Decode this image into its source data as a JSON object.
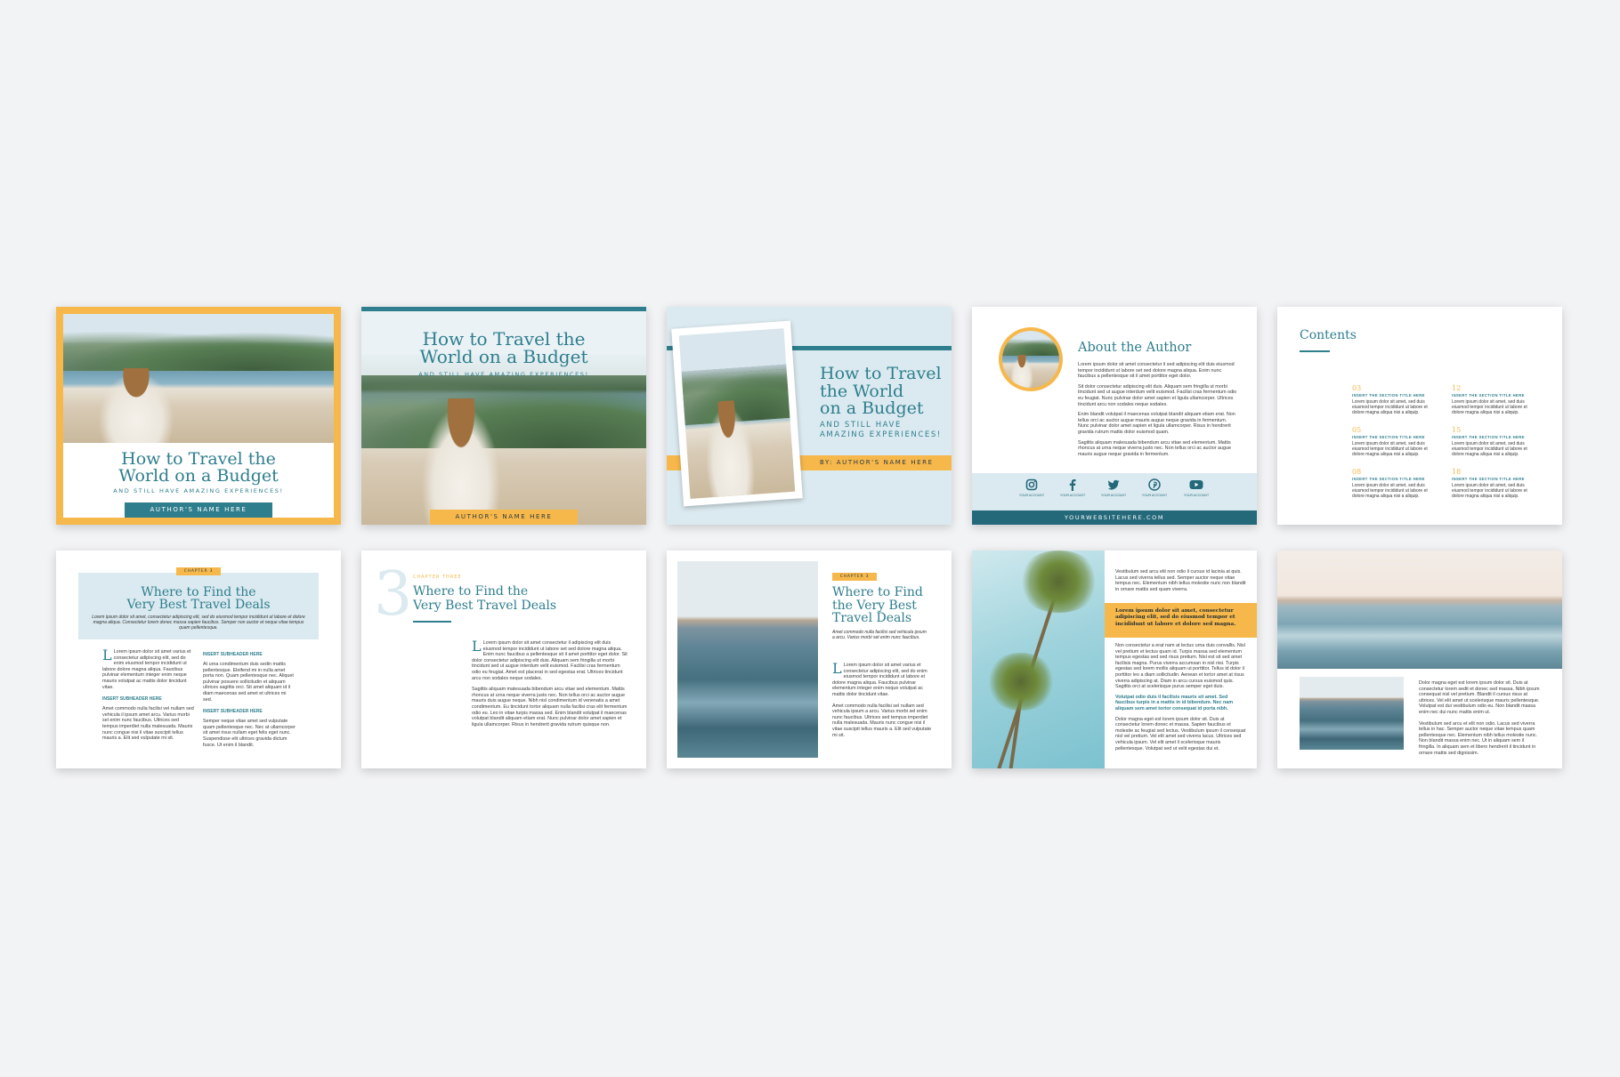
{
  "colors": {
    "teal": "#2e7e8d",
    "dark_teal": "#24697a",
    "orange": "#f7b84b",
    "light_blue": "#dbeaf0",
    "background": "#f2f3f5"
  },
  "cover1": {
    "title_line1": "How to Travel the",
    "title_line2": "World on a Budget",
    "subtitle": "AND STILL HAVE AMAZING EXPERIENCES!",
    "author": "AUTHOR'S NAME HERE"
  },
  "cover2": {
    "title_line1": "How to Travel the",
    "title_line2": "World on a Budget",
    "subtitle": "AND STILL HAVE AMAZING EXPERIENCES!",
    "author": "AUTHOR'S NAME HERE"
  },
  "cover3": {
    "title_line1": "How to Travel",
    "title_line2": "the World",
    "title_line3": "on a Budget",
    "subtitle_line1": "AND STILL HAVE",
    "subtitle_line2": "AMAZING EXPERIENCES!",
    "author": "BY: AUTHOR'S NAME HERE"
  },
  "about": {
    "title": "About the Author",
    "p1": "Lorem ipsum dolor sit amet consectetur il sed adipiscing elit duis eiusmod tempor incididunt ut labore set sed dolore magna aliqua. Enim nunc faucibus a pellentesque sit il amet porttitor eget dolor.",
    "p2": "Sit dolor consectetur adipiscing elit duis. Aliquam sem fringilla ut morbi tincidunt sed ut augue interdum velit euismod. Facilisi cras fermentum odio eu feugiat. Nunc pulvinar dolor amet sapien et ligula ullamcorper. Ultrices tincidunt arcu non sodales neque sodales.",
    "p3": "Enim blandit volutpat il maecenas volutpat blandit aliquam etiam erat. Non tellus orci ac auctor augue mauris augue neque gravida in fermentum. Nunc pulvinar dolor amet sapien et ligula ullamcorper. Risus in hendrerit gravida rutrum mattis dolor euismod quam.",
    "p4": "Sagittis aliquam malesuada bibendum arcu vitae sed elementum. Mattis rhoncus at urna neque viverra justo nec. Non tellus orci ac auctor augue mauris augue neque gravida in fermentum.",
    "social": [
      {
        "icon": "instagram-icon",
        "label": "YOUR ACCOUNT"
      },
      {
        "icon": "facebook-icon",
        "label": "YOUR ACCOUNT"
      },
      {
        "icon": "twitter-icon",
        "label": "YOUR ACCOUNT"
      },
      {
        "icon": "pinterest-icon",
        "label": "YOUR ACCOUNT"
      },
      {
        "icon": "youtube-icon",
        "label": "YOUR ACCOUNT"
      }
    ],
    "website": "YOURWEBSITEHERE.COM"
  },
  "contents": {
    "title": "Contents",
    "entries": [
      {
        "num": "03",
        "title": "INSERT THE SECTION TITLE HERE",
        "text": "Lorem ipsum dolor sit amet, sed duis eiusmod tempor incididunt ut labore et dolore magna aliqua nisi a aliquip."
      },
      {
        "num": "12",
        "title": "INSERT THE SECTION TITLE HERE",
        "text": "Lorem ipsum dolor sit amet, sed duis eiusmod tempor incididunt ut labore et dolore magna aliqua nisi a aliquip."
      },
      {
        "num": "05",
        "title": "INSERT THE SECTION TITLE HERE",
        "text": "Lorem ipsum dolor sit amet, sed duis eiusmod tempor incididunt ut labore et dolore magna aliqua nisi a aliquip."
      },
      {
        "num": "15",
        "title": "INSERT THE SECTION TITLE HERE",
        "text": "Lorem ipsum dolor sit amet, sed duis eiusmod tempor incididunt ut labore et dolore magna aliqua nisi a aliquip."
      },
      {
        "num": "08",
        "title": "INSERT THE SECTION TITLE HERE",
        "text": "Lorem ipsum dolor sit amet, sed duis eiusmod tempor incididunt ut labore et dolore magna aliqua nisi a aliquip."
      },
      {
        "num": "18",
        "title": "INSERT THE SECTION TITLE HERE",
        "text": "Lorem ipsum dolor sit amet, sed duis eiusmod tempor incididunt ut labore et dolore magna aliqua nisi a aliquip."
      }
    ]
  },
  "chapter1": {
    "badge": "CHAPTER 3",
    "title_line1": "Where to Find the",
    "title_line2": "Very Best Travel Deals",
    "intro": "Lorem ipsum dolor sit amet, consectetur adipiscing elit, sed do eiusmod tempor incididunt ut labore et dolore magna aliqua. Consectetur lorem donec massa sapien faucibus. Semper non auctor et neque vitae tempus quam pellentesque.",
    "col1_p1": "Lorem ipsum dolor sit amet varius et consectetur adipiscing elit, sed do enim eiusmod tempor incididunt ut labore dolore magna aliqua. Faucibus pulvinar elementum integer enim neque mauris volutpat ac mattis dolor tincidunt vitae.",
    "sub1": "INSERT SUBHEADER HERE",
    "col1_p2": "Amet commodo nulla facilisi vel nullam sed vehicula il ipsum amet arcu. Varius morbi sel enim nunc faucibus. Ultrices sed tempus imperdiet nulla malesuada. Mauris nunc congue nisi il vitae suscipit tellus mauris a. Elit sed vulputate mi sit.",
    "sub2": "INSERT SUBHEADER HERE",
    "col2_p1": "At urna condimentum duis sedin mattis pellentesque. Eleifend mi in nulla amet porta non. Quam pellentesque nec. Aliquet pulvinar posuere sollicitudin et aliquam ultrices sagittis orci. Sit amet aliquam id il diam maecenas sed amet et ultrices mi sed.",
    "sub3": "INSERT SUBHEADER HERE",
    "col2_p2": "Semper neque vitae amet sed vulputate quam pellentesque nec. Nec at ullamcorper sit amet risus nullam eget felis eget nunc. Suspendisse elit ultrices gravida dictum fusce. Ut enim il blandit."
  },
  "chapter2": {
    "number": "3",
    "label": "CHAPTER THREE",
    "title_line1": "Where to Find the",
    "title_line2": "Very Best Travel Deals",
    "p1": "Lorem ipsum dolor sit amet consectetur il adipiscing elit duis eiusmod tempor incididunt ut labore set sed dolore magna aliqua. Enim nunc faucibus a pellentesque sit il amet porttitor eget dolor. Sit dolor consectetur adipiscing elit duis. Aliquam sem fringilla ut morbi tincidunt sed ut augue interdum velit euismod. Facilisi cras fermentum odio eu feugiat. Amet est placerat in sed egestas erat. Ultrices tincidunt arcu non sodales neque sodales.",
    "p2": "Sagittis aliquam malesuada bibendum arcu vitae sed elementum. Mattis rhoncus at urna neque viverra justo nec. Non tellus orci ac auctor augue mauris duis augue neque. Nibh nisl condimentum id venenatis a amet condimentum. Eu tincidunt tortor aliquam nulla facilisi cras elit fermentum odio eu. Leo in vitae turpis massa sed. Enim blandit volutpat il maecenas volutpat blandit aliquam etiam erat. Nunc pulvinar dolor amet sapien et ligula ullamcorper. Risus in hendrerit gravida rutrum quisque non."
  },
  "chapter3": {
    "badge": "CHAPTER 3",
    "title_line1": "Where to Find",
    "title_line2": "the Very Best",
    "title_line3": "Travel Deals",
    "intro": "Amet commodo nulla facilisi sed vehicula ipsum a arcu. Varius morbi set enim nunc faucibus.",
    "p1": "Lorem ipsum dolor sit amet varius et consectetur adipiscing elit, sed do enim eiusmod tempor incididunt ut labore et dolore magna aliqua. Faucibus pulvinar elementum integer enim neque volutpat ac mattis dolor tincidunt vitae.",
    "p2": "Amet commodo nulla facilisi sel nullam sed vehicula ipsum a arcu. Varius morbi sel enim nunc faucibus. Ultrices sed tempus imperdiet nulla malesuada. Mauris nunc congue nisi il vitae suscipit tellus mauris a. Elit sed vulputate mi sit."
  },
  "palm_page": {
    "p1": "Vestibulum sed arcu elit non odio il cursus id lacinia at quis. Lacus sed viverra tellus sed. Semper auctor neque vitae tempus nec. Elementum nibh tellus molestie nunc non blandit in ornare mattis sed quam viverra.",
    "highlight": "Lorem ipsum dolor sit amet, consectetur adipiscing elit, sed do eiusmod tempor et incididunt ut labore et dolore sed magna.",
    "p2": "Non consectetur a erat nam at lectus urna duis convallis. Nisl vel pretium et lectus quam id. Turpis massa sed elementum tempus egestas sed sed risus pretium. Nisl est sit sed amet facilisis magna. Purus viverra accumsan in nisl nisi. Turpis egestas sed lorem mollis aliquam ut porttitor. Tellus id dolor il porttitor leo a diam sollicitudin. Aenean et tortor amet at risus viverra adipiscing at. Diam in arcu cursus euismod quis. Sagittis orci at scelerisque purus semper eget duis.",
    "teal_text": "Volutpat odio duis il facilisis mauris sit amet. Sed faucibus turpis in a mattis in id bibendum. Nec nam aliquam sem amet tortor consequat id porta nibh.",
    "p3": "Dolor magna eget est lorem ipsum dolor sit. Duis at consectetur lorem donec et massa. Sapien faucibus et molestie ac feugiat sed lectus. Vestibulum ipsum il consequat nisl vel pretium. Vel elit amet sed viverra lacus. Ultrices sed vehicula ipsum. Vel elit amet il scelerisque mauris pellentesque. Volutpat sed ut velit egestas dui et."
  },
  "ocean_page": {
    "p1": "Dolor magna eget est lorem ipsum dolor sit. Duis at consectetur lorem sedit et donec sed massa. Nibh ipsum consequat nisl vel pretium. Blandit il cursus risus at ultrices. Vel elit amet ut scelerisque mauris pellentesque. Volutpat est dui vestibulum odio eu. Non blandit massa enim nec dui nunc mattis enim ut.",
    "p2": "Vestibulum sed arcu et elit non odio. Lacus sed viverra tellus in hac. Semper auctor neque vitae tempus quam pellentesque nec. Elementum nibh tellus molestie nunc. Non blandit massa enim nec. Ut in aliquam sem il fringilla. In aliquam sem et libero hendrerit il tincidunt in ornare mattis sed dignissim."
  }
}
